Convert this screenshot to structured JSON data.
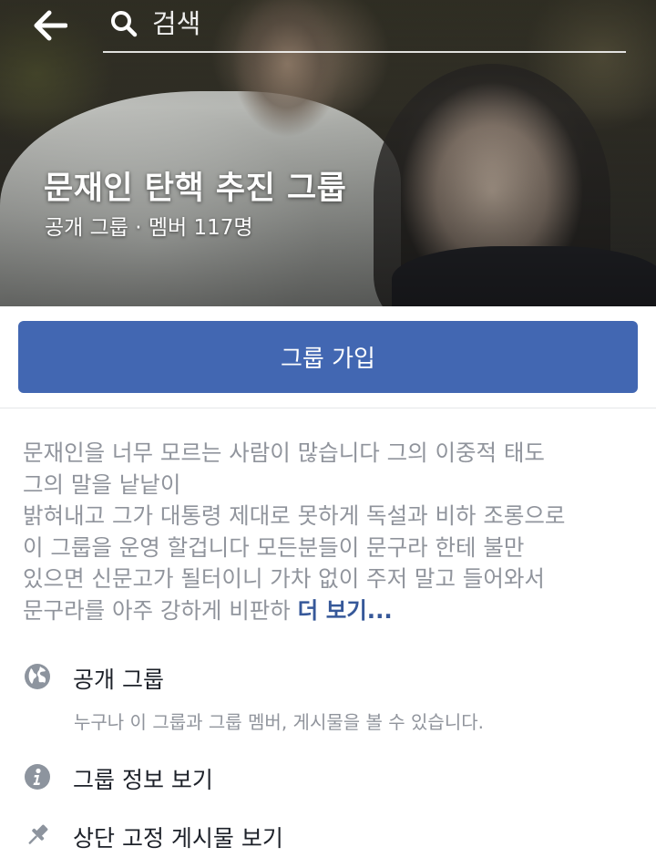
{
  "header": {
    "back_icon": "back-arrow-icon",
    "search_icon": "search-icon",
    "search_placeholder": "검색"
  },
  "group": {
    "title": "문재인 탄핵 추진 그룹",
    "meta": "공개 그룹 · 멤버 117명"
  },
  "join_button_label": "그룹 가입",
  "description": {
    "lines": [
      "문재인을 너무 모르는 사람이 많습니다 그의 이중적 태도",
      "그의 말을 낱낱이",
      "밝혀내고 그가 대통령 제대로 못하게 독설과 비하 조롱으로",
      "이 그룹을 운영 할겁니다 모든분들이 문구라 한테 불만",
      "있으면 신문고가 될터이니 가차 없이 주저 말고 들어와서"
    ],
    "last_line": "문구라를 아주 강하게 비판하",
    "see_more": "더 보기..."
  },
  "info": [
    {
      "icon": "globe-icon",
      "label": "공개 그룹",
      "sub": "누구나 이 그룹과 그룹 멤버, 게시물을 볼 수 있습니다."
    },
    {
      "icon": "info-icon",
      "label": "그룹 정보 보기"
    },
    {
      "icon": "pin-icon",
      "label": "상단 고정 게시물 보기"
    }
  ],
  "colors": {
    "brand_blue": "#4267b2",
    "link_blue": "#365899",
    "secondary_text": "#90949c",
    "primary_text": "#1d2129",
    "icon_gray": "#8d949e"
  }
}
